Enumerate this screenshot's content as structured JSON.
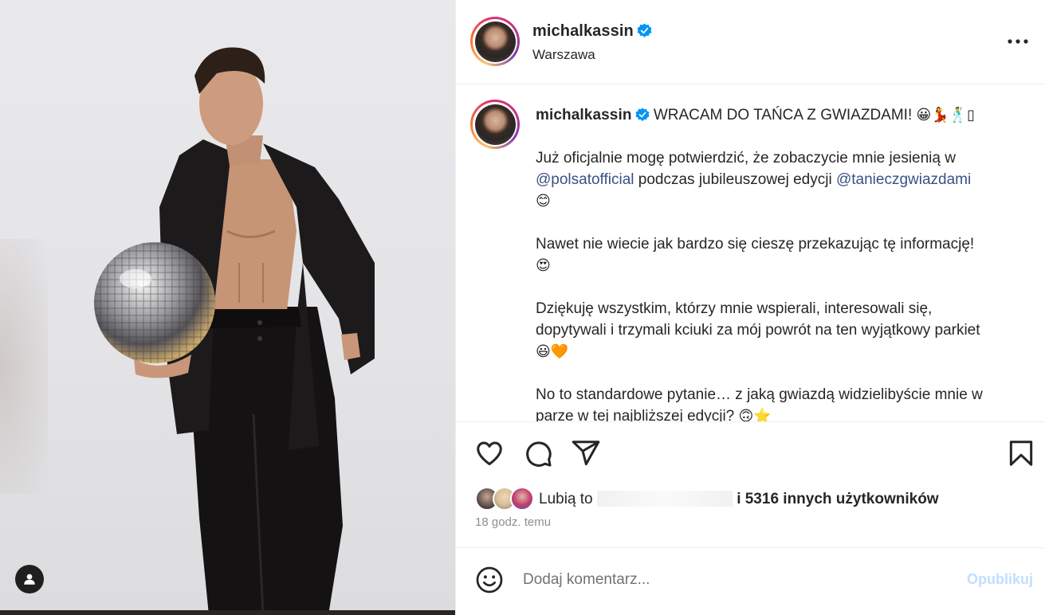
{
  "post": {
    "username": "michalkassin",
    "location": "Warszawa",
    "more_label": "•••"
  },
  "caption": {
    "username": "michalkassin",
    "headline": "WRACAM DO TAŃCA Z GWIAZDAMI!",
    "headline_emoji": "😀💃🕺▯",
    "p1_text": "Już oficjalnie mogę potwierdzić, że zobaczycie mnie jesienią w",
    "p1_mention1": "@polsatofficial",
    "p1_middle": " podczas jubileuszowej edycji ",
    "p1_mention2": "@tanieczgwiazdami",
    "p1_emoji": "😊",
    "p2_text": "Nawet nie wiecie jak bardzo się cieszę przekazując tę informację!",
    "p2_emoji": "😍",
    "p3_text": "Dziękuję wszystkim, którzy mnie wspierali, interesowali się, dopytywali i trzymali kciuki za mój powrót na ten wyjątkowy parkiet",
    "p3_emoji": "😃🧡",
    "p4_text": "No to standardowe pytanie… z jaką gwiazdą widzielibyście mnie w parze w tej najbliższej edycji?",
    "p4_emoji": "🙃⭐"
  },
  "likes": {
    "prefix": "Lubią to",
    "suffix": "i 5316 innych użytkowników"
  },
  "timestamp": "18 godz. temu",
  "comment": {
    "placeholder": "Dodaj komentarz...",
    "publish_label": "Opublikuj"
  },
  "colors": {
    "verified": "#0095f6",
    "mention": "#385185",
    "publish_disabled": "#c0dffd"
  },
  "icons": [
    "user-tag-icon",
    "verified-icon",
    "more-icon",
    "heart-icon",
    "comment-icon",
    "share-icon",
    "bookmark-icon",
    "emoji-icon"
  ]
}
